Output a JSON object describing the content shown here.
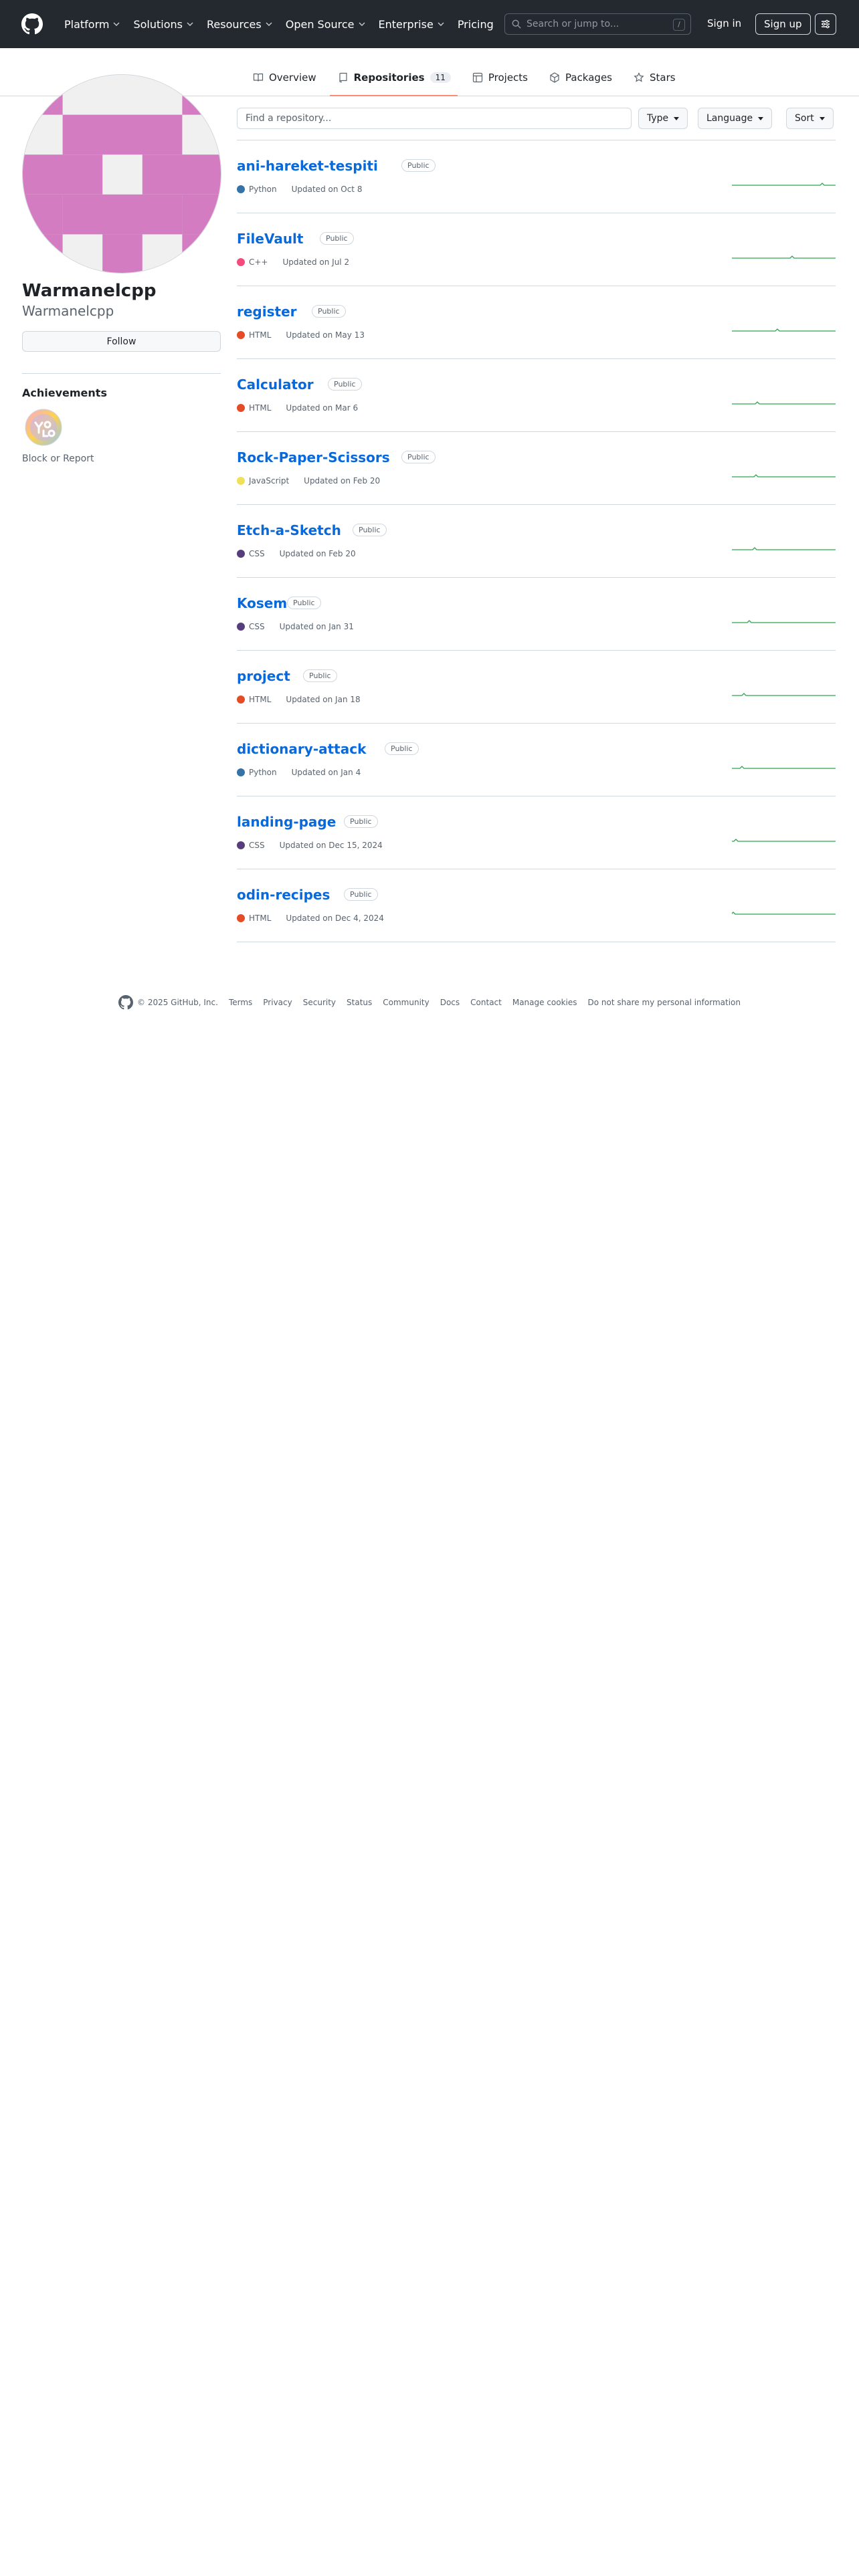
{
  "header": {
    "nav": [
      {
        "label": "Platform",
        "dropdown": true
      },
      {
        "label": "Solutions",
        "dropdown": true
      },
      {
        "label": "Resources",
        "dropdown": true
      },
      {
        "label": "Open Source",
        "dropdown": true
      },
      {
        "label": "Enterprise",
        "dropdown": true
      },
      {
        "label": "Pricing",
        "dropdown": false
      }
    ],
    "search_placeholder": "Search or jump to...",
    "search_shortcut": "/",
    "sign_in": "Sign in",
    "sign_up": "Sign up"
  },
  "tabs": [
    {
      "label": "Overview",
      "icon": "book-icon",
      "active": false
    },
    {
      "label": "Repositories",
      "icon": "repo-icon",
      "active": true,
      "count": "11"
    },
    {
      "label": "Projects",
      "icon": "table-icon",
      "active": false
    },
    {
      "label": "Packages",
      "icon": "package-icon",
      "active": false
    },
    {
      "label": "Stars",
      "icon": "star-icon",
      "active": false
    }
  ],
  "profile": {
    "name": "Warmanelcpp",
    "login": "Warmanelcpp",
    "follow_label": "Follow",
    "achievements_title": "Achievements",
    "block_report": "Block or Report",
    "avatar_color": "#d47cc1"
  },
  "filters": {
    "find_placeholder": "Find a repository...",
    "type_label": "Type",
    "language_label": "Language",
    "sort_label": "Sort"
  },
  "repos": [
    {
      "name": "ani-hareket-tespiti",
      "visibility": "Public",
      "language": "Python",
      "lang_color": "#3572A5",
      "updated": "Updated on Oct 8"
    },
    {
      "name": "FileVault",
      "visibility": "Public",
      "language": "C++",
      "lang_color": "#f34b7d",
      "updated": "Updated on Jul 2"
    },
    {
      "name": "register",
      "visibility": "Public",
      "language": "HTML",
      "lang_color": "#e34c26",
      "updated": "Updated on May 13"
    },
    {
      "name": "Calculator",
      "visibility": "Public",
      "language": "HTML",
      "lang_color": "#e34c26",
      "updated": "Updated on Mar 6"
    },
    {
      "name": "Rock-Paper-Scissors",
      "visibility": "Public",
      "language": "JavaScript",
      "lang_color": "#f1e05a",
      "updated": "Updated on Feb 20"
    },
    {
      "name": "Etch-a-Sketch",
      "visibility": "Public",
      "language": "CSS",
      "lang_color": "#563d7c",
      "updated": "Updated on Feb 20"
    },
    {
      "name": "Kosem",
      "visibility": "Public",
      "language": "CSS",
      "lang_color": "#563d7c",
      "updated": "Updated on Jan 31"
    },
    {
      "name": "project",
      "visibility": "Public",
      "language": "HTML",
      "lang_color": "#e34c26",
      "updated": "Updated on Jan 18"
    },
    {
      "name": "dictionary-attack",
      "visibility": "Public",
      "language": "Python",
      "lang_color": "#3572A5",
      "updated": "Updated on Jan 4"
    },
    {
      "name": "landing-page",
      "visibility": "Public",
      "language": "CSS",
      "lang_color": "#563d7c",
      "updated": "Updated on Dec 15, 2024"
    },
    {
      "name": "odin-recipes",
      "visibility": "Public",
      "language": "HTML",
      "lang_color": "#e34c26",
      "updated": "Updated on Dec 4, 2024"
    }
  ],
  "footer": {
    "copyright": "© 2025 GitHub, Inc.",
    "links": [
      "Terms",
      "Privacy",
      "Security",
      "Status",
      "Community",
      "Docs",
      "Contact",
      "Manage cookies",
      "Do not share my personal information"
    ]
  }
}
